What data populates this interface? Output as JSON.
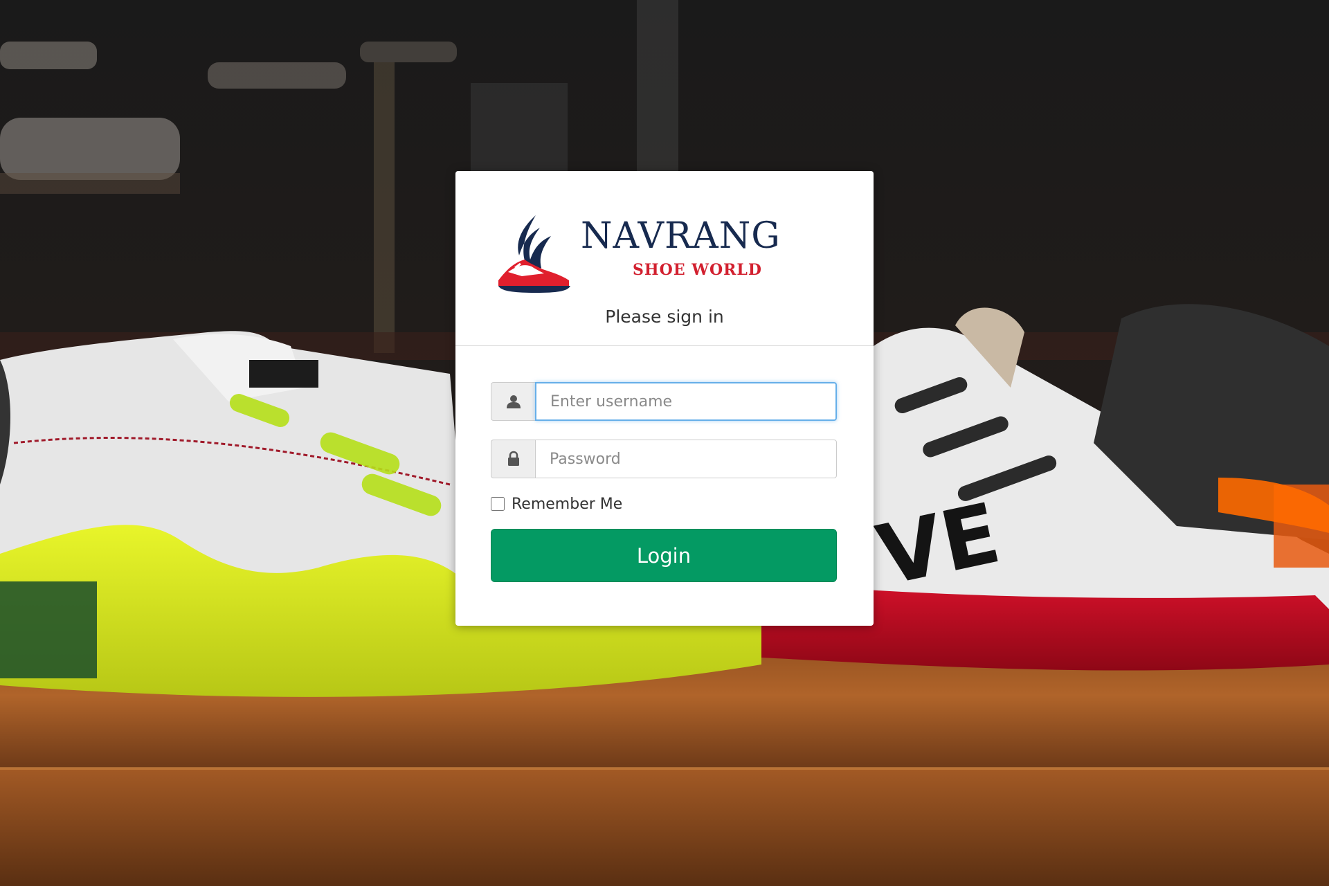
{
  "background": {
    "description_icon": "shoe-store-photo"
  },
  "login": {
    "brand_name": "NAVRANG",
    "brand_subtitle": "SHOE WORLD",
    "logo_icon": "winged-shoe-icon",
    "heading": "Please sign in",
    "username": {
      "icon": "user-icon",
      "placeholder": "Enter username",
      "value": ""
    },
    "password": {
      "icon": "lock-icon",
      "placeholder": "Password",
      "value": ""
    },
    "remember_label": "Remember Me",
    "remember_checked": false,
    "submit_label": "Login"
  },
  "colors": {
    "brand_navy": "#172a4f",
    "brand_red": "#d2202f",
    "login_green": "#049a63",
    "focus_blue": "#66afe9"
  }
}
